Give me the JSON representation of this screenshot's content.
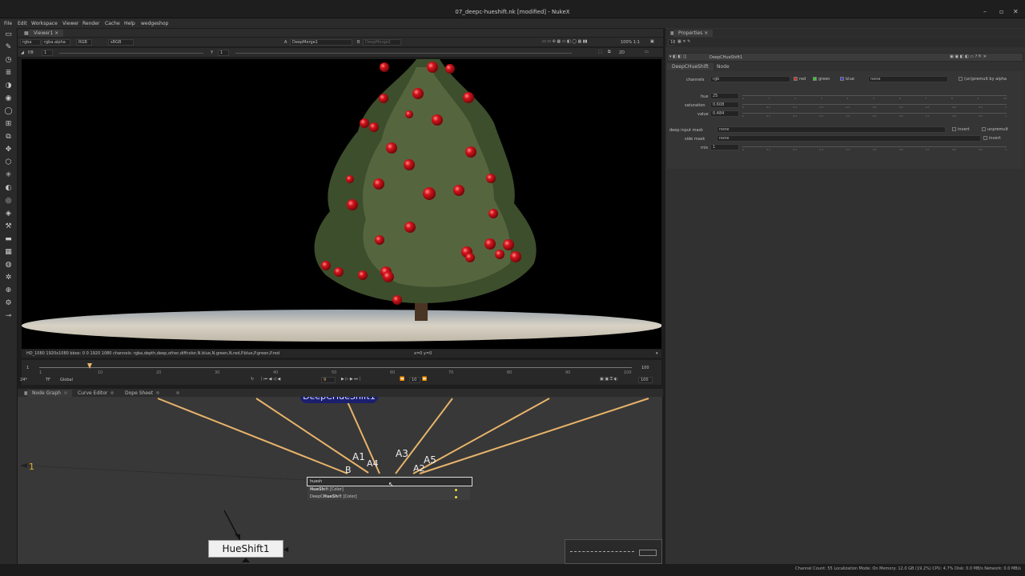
{
  "window": {
    "title": "07_deepc-hueshift.nk [modified] - NukeX"
  },
  "menubar": {
    "items": [
      "File",
      "Edit",
      "Workspace",
      "Viewer",
      "Render",
      "Cache",
      "Help",
      "wedgeshop"
    ]
  },
  "viewer": {
    "tab_label": "Viewer1",
    "channels": "rgba",
    "alpha": "rgba.alpha",
    "display": "RGB",
    "colorspace": "sRGB",
    "input_a_label": "A",
    "input_a": "DeepMerge1",
    "input_b_label": "B",
    "input_b": "DeepMerge1",
    "gain": "f/8",
    "gain_value": "1",
    "gamma_label": "Y",
    "gamma_value": "1",
    "zoom": "100%",
    "ratio": "1:1",
    "mode": "2D",
    "info": "HD_1080 1920x1080  bbox: 0 0 1920 1080 channels: rgba,depth,deep,other,diffcolor,N.blue,N.green,N.red,P.blue,P.green,P.red",
    "coords": "x=0 y=0"
  },
  "timeline": {
    "start": "1",
    "end": "100",
    "ticks": [
      "1",
      "10",
      "20",
      "30",
      "40",
      "50",
      "60",
      "70",
      "80",
      "90",
      "100"
    ],
    "current_frame": "9",
    "fps": "24*",
    "tf": "TF",
    "scope": "Global",
    "increment": "10",
    "end_frame_field": "100"
  },
  "panels": {
    "tabs": [
      "Node Graph",
      "Curve Editor",
      "Dope Sheet"
    ]
  },
  "nodegraph": {
    "top_node": "DeepCHueShift1",
    "input_labels": [
      "A1",
      "A4",
      "A3",
      "A5",
      "B",
      "A2"
    ],
    "marker": "1",
    "search_text": "huesh",
    "results": [
      {
        "bold": "HueSh",
        "rest": "ift [Color]",
        "prefix": ""
      },
      {
        "bold": "HueSh",
        "rest": "ift [Color]",
        "prefix": "DeepC"
      }
    ],
    "hueshift_node": "HueShift1"
  },
  "properties": {
    "tab_label": "Properties",
    "panel_count": "10",
    "node_name": "DeepCHueShift1",
    "tabs": [
      "DeepCHueShift",
      "Node"
    ],
    "channels_label": "channels",
    "channels_value": "rgb",
    "red": "red",
    "green": "green",
    "blue": "blue",
    "channel4": "none",
    "unpremult_alpha": "(un)premult by alpha",
    "hue_label": "hue",
    "hue_value": "25",
    "saturation_label": "saturation",
    "saturation_value": "0.608",
    "value_label": "value",
    "value_value": "0.484",
    "deep_mask_label": "deep input mask",
    "deep_mask_value": "none",
    "invert_label": "invert",
    "unpremult_label": "unpremult",
    "side_mask_label": "side mask",
    "side_mask_value": "none",
    "side_invert_label": "invert",
    "mix_label": "mix",
    "mix_value": "1"
  },
  "status": {
    "text": "Channel Count: 55  Localization Mode: On  Memory: 12.0 GB (19.2%)  CPU: 4.7%  Disk: 0.0 MB/s  Network: 0.0 MB/s"
  },
  "colors": {
    "accent": "#e8b36a",
    "node_blue": "#1b1f6e",
    "bauble_red": "#c8121b"
  }
}
